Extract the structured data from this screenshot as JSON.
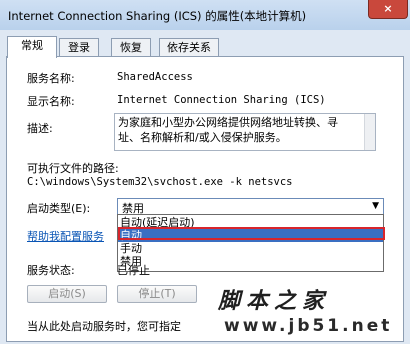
{
  "window": {
    "title": "Internet Connection Sharing (ICS) 的属性(本地计算机)",
    "close_glyph": "×"
  },
  "tabs": [
    "常规",
    "登录",
    "恢复",
    "依存关系"
  ],
  "general": {
    "service_name_label": "服务名称:",
    "service_name_value": "SharedAccess",
    "display_name_label": "显示名称:",
    "display_name_value": "Internet Connection Sharing (ICS)",
    "description_label": "描述:",
    "description_line1": "为家庭和小型办公网络提供网络地址转换、寻",
    "description_line2": "址、名称解析和/或入侵保护服务。",
    "exe_path_label": "可执行文件的路径:",
    "exe_path_value": "C:\\windows\\System32\\svchost.exe -k netsvcs",
    "startup_type_label": "启动类型(E):",
    "startup_type_value": "禁用",
    "startup_options": [
      "自动(延迟启动)",
      "自动",
      "手动",
      "禁用"
    ],
    "help_link": "帮助我配置服务",
    "status_label": "服务状态:",
    "status_value": "已停止",
    "buttons": {
      "start": "启动(S)",
      "stop": "停止(T)"
    },
    "bottom_text": "当从此处启动服务时，您可指定"
  },
  "watermark": {
    "line1": "脚本之家",
    "line2": "www.jb51.net"
  },
  "colors": {
    "selection": "#3a6fc2",
    "highlight_border": "#d8252c",
    "link": "#0a55b5"
  }
}
